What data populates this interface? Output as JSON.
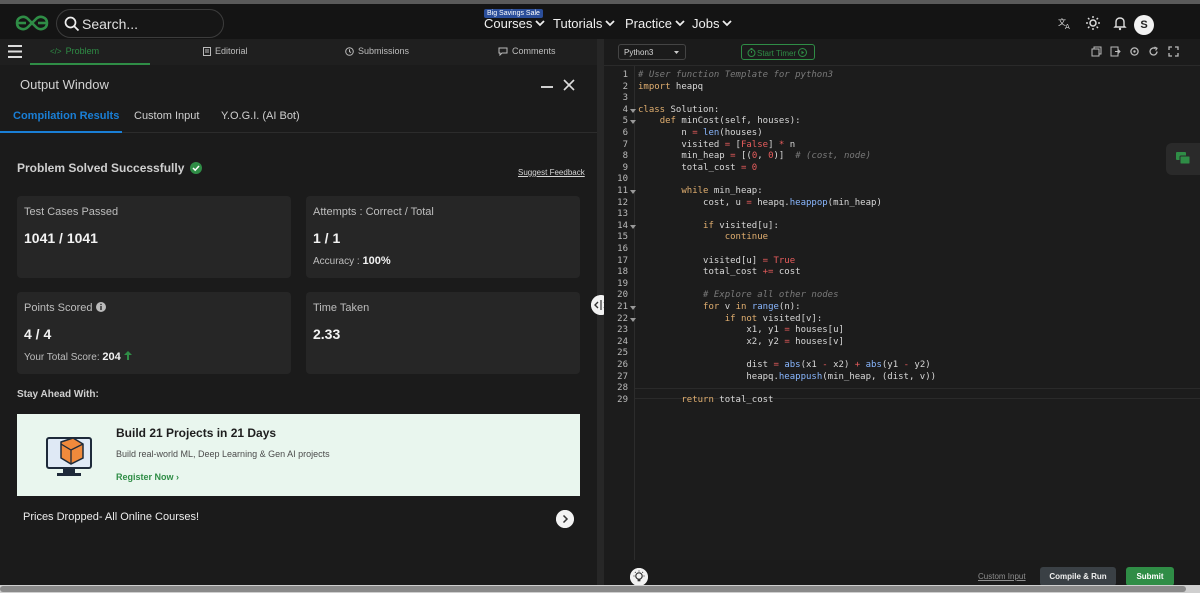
{
  "topbar": {
    "search_placeholder": "Search...",
    "nav": [
      {
        "label": "Courses"
      },
      {
        "label": "Tutorials"
      },
      {
        "label": "Practice"
      },
      {
        "label": "Jobs"
      }
    ],
    "sale_badge": "Big Savings Sale",
    "avatar_letter": "S"
  },
  "problem_tabs": [
    {
      "label": "Problem",
      "icon": "code-icon"
    },
    {
      "label": "Editorial",
      "icon": "document-icon"
    },
    {
      "label": "Submissions",
      "icon": "clock-icon"
    },
    {
      "label": "Comments",
      "icon": "comment-icon"
    }
  ],
  "output": {
    "title": "Output Window",
    "tabs": [
      "Compilation Results",
      "Custom Input",
      "Y.O.G.I. (AI Bot)"
    ],
    "status": "Problem Solved Successfully",
    "suggest_feedback": "Suggest Feedback",
    "cards": {
      "test_cases": {
        "label": "Test Cases Passed",
        "value": "1041 / 1041"
      },
      "attempts": {
        "label": "Attempts : Correct / Total",
        "value": "1 / 1",
        "accuracy_label": "Accuracy :",
        "accuracy_value": "100%"
      },
      "points": {
        "label": "Points Scored",
        "value": "4 / 4",
        "total_label": "Your Total Score:",
        "total_value": "204"
      },
      "time": {
        "label": "Time Taken",
        "value": "2.33"
      }
    },
    "stay_ahead": "Stay Ahead With:",
    "promo": {
      "title": "Build 21 Projects in 21 Days",
      "desc": "Build real-world ML, Deep Learning & Gen AI projects",
      "cta": "Register Now ›"
    },
    "prices": "Prices Dropped- All Online Courses!"
  },
  "editor": {
    "language": "Python3",
    "timer_label": "Start Timer",
    "custom_input": "Custom Input",
    "compile_label": "Compile & Run",
    "submit_label": "Submit",
    "lines": [
      "# User function Template for python3",
      "import heapq",
      "",
      "class Solution:",
      "    def minCost(self, houses):",
      "        n = len(houses)",
      "        visited = [False] * n",
      "        min_heap = [(0, 0)]  # (cost, node)",
      "        total_cost = 0",
      "",
      "        while min_heap:",
      "            cost, u = heapq.heappop(min_heap)",
      "",
      "            if visited[u]:",
      "                continue",
      "",
      "            visited[u] = True",
      "            total_cost += cost",
      "",
      "            # Explore all other nodes",
      "            for v in range(n):",
      "                if not visited[v]:",
      "                    x1, y1 = houses[u]",
      "                    x2, y2 = houses[v]",
      "",
      "                    dist = abs(x1 - x2) + abs(y1 - y2)",
      "                    heapq.heappush(min_heap, (dist, v))",
      "",
      "        return total_cost"
    ],
    "fold_lines": [
      4,
      5,
      11,
      14,
      21,
      22
    ]
  },
  "colors": {
    "accent_green": "#2f8d46",
    "accent_blue": "#1a7fd6"
  }
}
